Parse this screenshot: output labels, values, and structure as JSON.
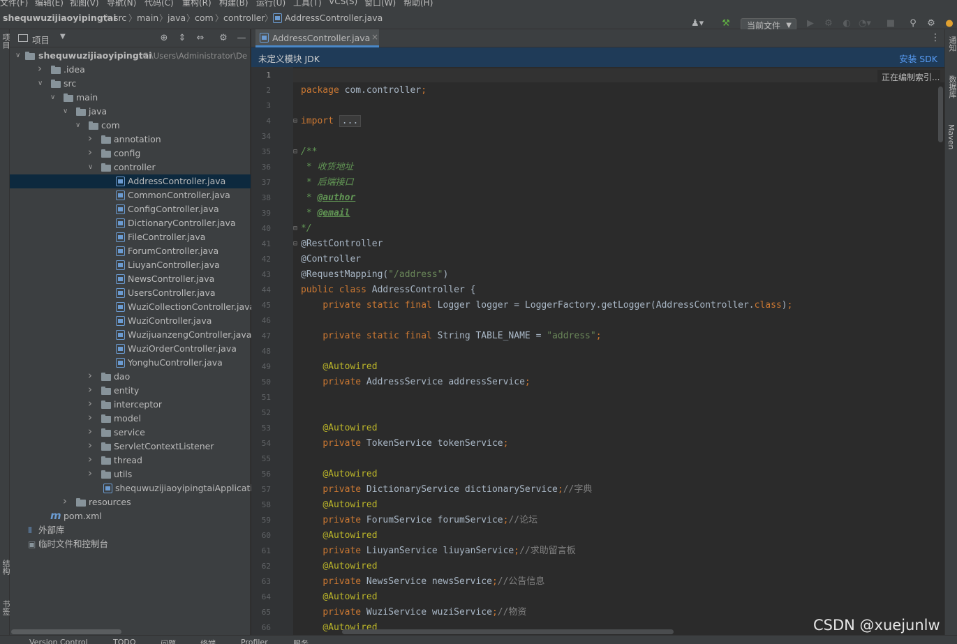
{
  "menu": [
    "文件(F)",
    "编辑(E)",
    "视图(V)",
    "导航(N)",
    "代码(C)",
    "重构(R)",
    "构建(B)",
    "运行(U)",
    "工具(T)",
    "VCS(S)",
    "窗口(W)",
    "帮助(H)"
  ],
  "breadcrumbs": [
    "shequwuzijiaoyipingtai",
    "src",
    "main",
    "java",
    "com",
    "controller",
    "AddressController.java"
  ],
  "toolbar": {
    "run_config": "当前文件"
  },
  "left_strip": {
    "top_label": "项目",
    "mid_label": "结构",
    "bottom_label": "书签"
  },
  "right_strip": {
    "notifications": "通知",
    "database": "数据库",
    "maven": "Maven"
  },
  "project": {
    "title": "项目",
    "root_name": "shequwuzijiaoyipingtai",
    "root_path": "C:\\Users\\Administrator\\De",
    "items": [
      {
        "label": ".idea",
        "kind": "folder",
        "depth": 1,
        "expanded": false
      },
      {
        "label": "src",
        "kind": "folder",
        "depth": 1,
        "expanded": true
      },
      {
        "label": "main",
        "kind": "folder",
        "depth": 2,
        "expanded": true
      },
      {
        "label": "java",
        "kind": "folder",
        "depth": 3,
        "expanded": true
      },
      {
        "label": "com",
        "kind": "folder",
        "depth": 4,
        "expanded": true
      },
      {
        "label": "annotation",
        "kind": "folder",
        "depth": 5,
        "expanded": false
      },
      {
        "label": "config",
        "kind": "folder",
        "depth": 5,
        "expanded": false
      },
      {
        "label": "controller",
        "kind": "folder",
        "depth": 5,
        "expanded": true
      },
      {
        "label": "AddressController.java",
        "kind": "java",
        "depth": 6,
        "selected": true
      },
      {
        "label": "CommonController.java",
        "kind": "java",
        "depth": 6
      },
      {
        "label": "ConfigController.java",
        "kind": "java",
        "depth": 6
      },
      {
        "label": "DictionaryController.java",
        "kind": "java",
        "depth": 6
      },
      {
        "label": "FileController.java",
        "kind": "java",
        "depth": 6
      },
      {
        "label": "ForumController.java",
        "kind": "java",
        "depth": 6
      },
      {
        "label": "LiuyanController.java",
        "kind": "java",
        "depth": 6
      },
      {
        "label": "NewsController.java",
        "kind": "java",
        "depth": 6
      },
      {
        "label": "UsersController.java",
        "kind": "java",
        "depth": 6
      },
      {
        "label": "WuziCollectionController.java",
        "kind": "java",
        "depth": 6
      },
      {
        "label": "WuziController.java",
        "kind": "java",
        "depth": 6
      },
      {
        "label": "WuzijuanzengController.java",
        "kind": "java",
        "depth": 6
      },
      {
        "label": "WuziOrderController.java",
        "kind": "java",
        "depth": 6
      },
      {
        "label": "YonghuController.java",
        "kind": "java",
        "depth": 6
      },
      {
        "label": "dao",
        "kind": "folder",
        "depth": 5,
        "expanded": false
      },
      {
        "label": "entity",
        "kind": "folder",
        "depth": 5,
        "expanded": false
      },
      {
        "label": "interceptor",
        "kind": "folder",
        "depth": 5,
        "expanded": false
      },
      {
        "label": "model",
        "kind": "folder",
        "depth": 5,
        "expanded": false
      },
      {
        "label": "service",
        "kind": "folder",
        "depth": 5,
        "expanded": false
      },
      {
        "label": "ServletContextListener",
        "kind": "folder",
        "depth": 5,
        "expanded": false
      },
      {
        "label": "thread",
        "kind": "folder",
        "depth": 5,
        "expanded": false
      },
      {
        "label": "utils",
        "kind": "folder",
        "depth": 5,
        "expanded": false
      },
      {
        "label": "shequwuzijiaoyipingtaiApplication.jav",
        "kind": "java",
        "depth": 5
      },
      {
        "label": "resources",
        "kind": "folder",
        "depth": 3,
        "expanded": false
      },
      {
        "label": "pom.xml",
        "kind": "maven",
        "depth": 1
      },
      {
        "label": "外部库",
        "kind": "lib",
        "depth": 0
      },
      {
        "label": "临时文件和控制台",
        "kind": "scratch",
        "depth": 0
      }
    ]
  },
  "editor": {
    "tab_label": "AddressController.java",
    "banner_message": "未定义模块 JDK",
    "banner_action": "安装 SDK",
    "indexing": "正在编制索引...",
    "lines": [
      {
        "n": "1",
        "html": ""
      },
      {
        "n": "2",
        "html": "<span class='kw'>package</span> com.controller<span class='kw'>;</span>"
      },
      {
        "n": "3",
        "html": ""
      },
      {
        "n": "4",
        "html": "<span class='kw'>import</span> <span class='fold-box'>...</span>"
      },
      {
        "n": "34",
        "html": ""
      },
      {
        "n": "35",
        "html": "<span class='doc'>/**</span>"
      },
      {
        "n": "36",
        "html": "<span class='doc'> * 收货地址</span>"
      },
      {
        "n": "37",
        "html": "<span class='doc'> * 后端接口</span>"
      },
      {
        "n": "38",
        "html": "<span class='doc'> * </span><span class='doctag'>@author</span>"
      },
      {
        "n": "39",
        "html": "<span class='doc'> * </span><span class='doctag'>@email</span>"
      },
      {
        "n": "40",
        "html": "<span class='doc'>*/</span>"
      },
      {
        "n": "41",
        "html": "<span class='ann2'>@RestController</span>"
      },
      {
        "n": "42",
        "html": "<span class='ann2'>@Controller</span>"
      },
      {
        "n": "43",
        "html": "<span class='ann2'>@RequestMapping(</span><span class='str'>\"/address\"</span><span class='ann2'>)</span>"
      },
      {
        "n": "44",
        "html": "<span class='kw'>public class</span> AddressController {"
      },
      {
        "n": "45",
        "html": "    <span class='kw'>private static final</span> Logger logger = LoggerFactory.getLogger(AddressController.<span class='kw'>class</span>)<span class='kw'>;</span>"
      },
      {
        "n": "46",
        "html": ""
      },
      {
        "n": "47",
        "html": "    <span class='kw'>private static final</span> String TABLE_NAME = <span class='str'>\"address\"</span><span class='kw'>;</span>"
      },
      {
        "n": "48",
        "html": ""
      },
      {
        "n": "49",
        "html": "    <span class='ann'>@Autowired</span>"
      },
      {
        "n": "50",
        "html": "    <span class='kw'>private</span> AddressService addressService<span class='kw'>;</span>"
      },
      {
        "n": "51",
        "html": ""
      },
      {
        "n": "52",
        "html": ""
      },
      {
        "n": "53",
        "html": "    <span class='ann'>@Autowired</span>"
      },
      {
        "n": "54",
        "html": "    <span class='kw'>private</span> TokenService tokenService<span class='kw'>;</span>"
      },
      {
        "n": "55",
        "html": ""
      },
      {
        "n": "56",
        "html": "    <span class='ann'>@Autowired</span>"
      },
      {
        "n": "57",
        "html": "    <span class='kw'>private</span> DictionaryService dictionaryService<span class='kw'>;</span><span class='cmt'>//字典</span>"
      },
      {
        "n": "58",
        "html": "    <span class='ann'>@Autowired</span>"
      },
      {
        "n": "59",
        "html": "    <span class='kw'>private</span> ForumService forumService<span class='kw'>;</span><span class='cmt'>//论坛</span>"
      },
      {
        "n": "60",
        "html": "    <span class='ann'>@Autowired</span>"
      },
      {
        "n": "61",
        "html": "    <span class='kw'>private</span> LiuyanService liuyanService<span class='kw'>;</span><span class='cmt'>//求助留言板</span>"
      },
      {
        "n": "62",
        "html": "    <span class='ann'>@Autowired</span>"
      },
      {
        "n": "63",
        "html": "    <span class='kw'>private</span> NewsService newsService<span class='kw'>;</span><span class='cmt'>//公告信息</span>"
      },
      {
        "n": "64",
        "html": "    <span class='ann'>@Autowired</span>"
      },
      {
        "n": "65",
        "html": "    <span class='kw'>private</span> WuziService wuziService<span class='kw'>;</span><span class='cmt'>//物资</span>"
      },
      {
        "n": "66",
        "html": "    <span class='ann'>@Autowired</span>"
      }
    ]
  },
  "bottombar": [
    "Version Control",
    "TODO",
    "问题",
    "终端",
    "Profiler",
    "服务"
  ],
  "watermark": "CSDN @xuejunlw"
}
